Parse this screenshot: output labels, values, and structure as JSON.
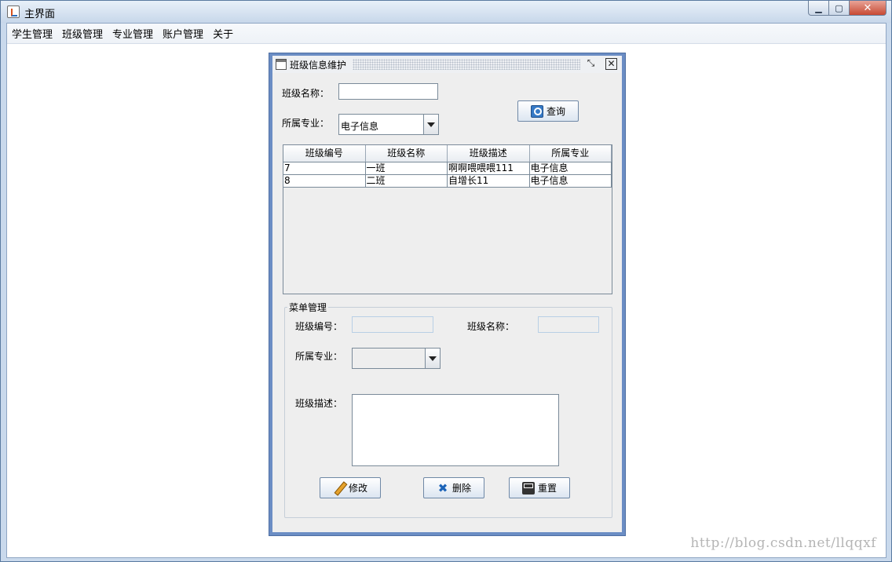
{
  "window": {
    "title": "主界面"
  },
  "menu": {
    "items": [
      "学生管理",
      "班级管理",
      "专业管理",
      "账户管理",
      "关于"
    ]
  },
  "frame": {
    "title": "班级信息维护",
    "search": {
      "name_label": "班级名称：",
      "name_value": "",
      "major_label": "所属专业：",
      "major_selected": "电子信息",
      "query_button": "查询"
    },
    "table": {
      "headers": [
        "班级编号",
        "班级名称",
        "班级描述",
        "所属专业"
      ],
      "rows": [
        [
          "7",
          "一班",
          "啊啊喂喂喂111",
          "电子信息"
        ],
        [
          "8",
          "二班",
          "自增长11",
          "电子信息"
        ]
      ]
    },
    "edit": {
      "legend": "菜单管理",
      "id_label": "班级编号：",
      "id_value": "",
      "name_label": "班级名称：",
      "name_value": "",
      "major_label": "所属专业：",
      "major_selected": "",
      "desc_label": "班级描述：",
      "desc_value": "",
      "modify_button": "修改",
      "delete_button": "删除",
      "reset_button": "重置"
    }
  },
  "watermark": "http://blog.csdn.net/llqqxf"
}
